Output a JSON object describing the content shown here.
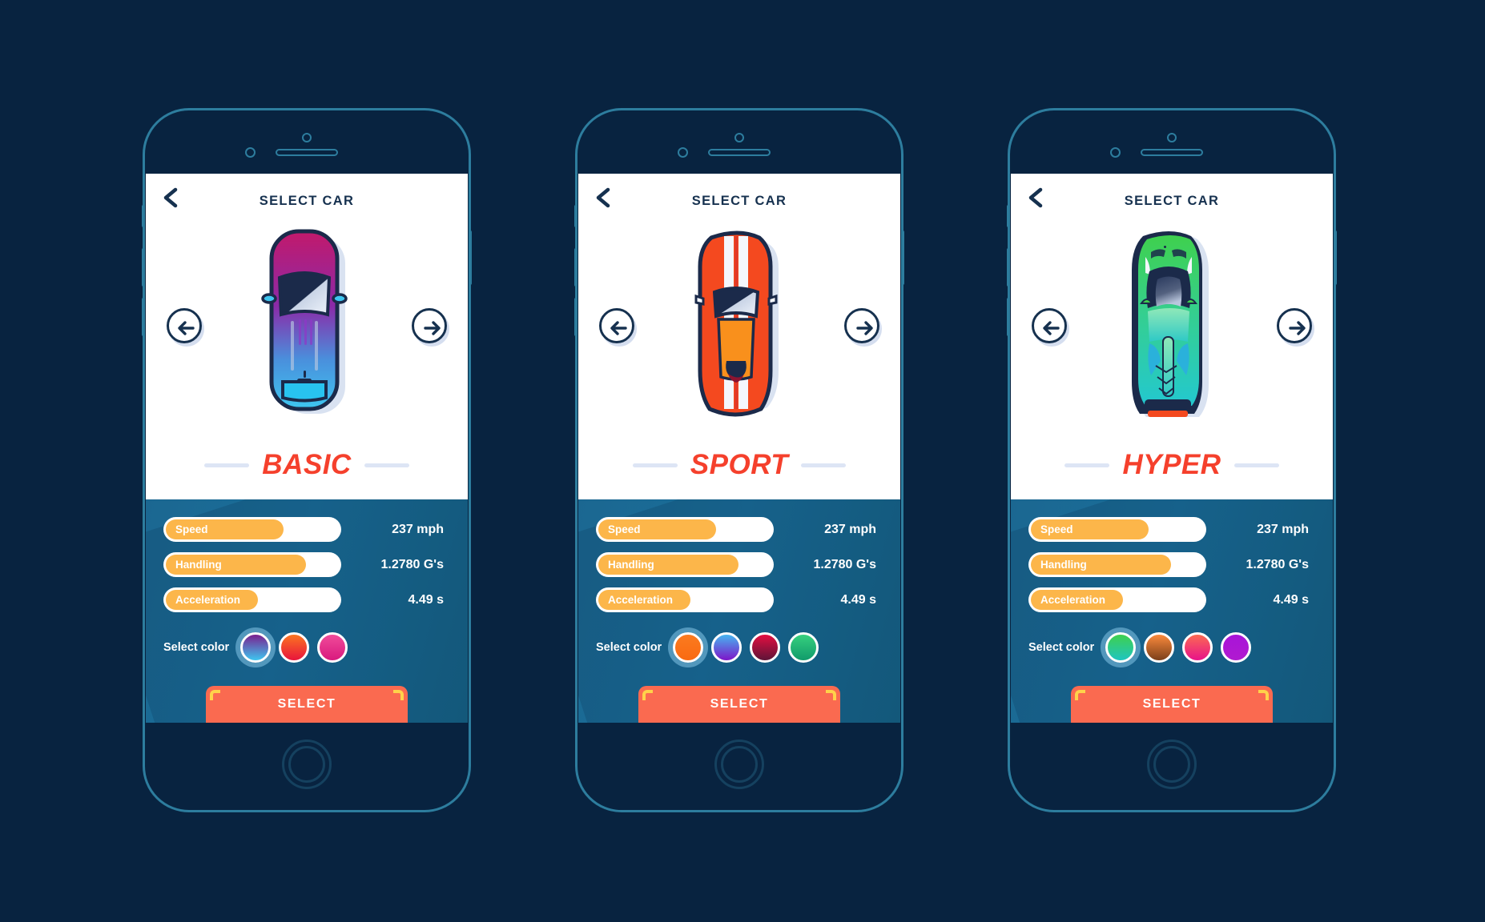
{
  "app": {
    "background_color": "#082340",
    "accent_red": "#f5402c",
    "bar_color": "#fcb64a",
    "panel_color": "#1a6f9b",
    "button_color": "#fa6a50"
  },
  "phones": [
    {
      "header": {
        "title": "SELECT CAR",
        "back_icon": "chevron-left-icon"
      },
      "carousel": {
        "prev_icon": "arrow-left-circle-icon",
        "next_icon": "arrow-right-circle-icon"
      },
      "car": {
        "name": "BASIC",
        "art": "car-top-view-sedan",
        "body_from": "#c21f6e",
        "body_to": "#3ec6f0"
      },
      "stats": [
        {
          "label": "Speed",
          "value": "237 mph",
          "pct": 66
        },
        {
          "label": "Handling",
          "value": "1.2780 G's",
          "pct": 79
        },
        {
          "label": "Acceleration",
          "value": "4.49 s",
          "pct": 52
        }
      ],
      "color_picker": {
        "label": "Select color",
        "swatches": [
          {
            "name": "purple-blue",
            "from": "#7b1f8f",
            "to": "#3ec6f0",
            "selected": true
          },
          {
            "name": "orange-red",
            "from": "#fb7521",
            "to": "#e8143c",
            "selected": false
          },
          {
            "name": "pink-magenta",
            "from": "#f04b9a",
            "to": "#d91a7e",
            "selected": false
          }
        ]
      },
      "select_button": {
        "label": "SELECT"
      }
    },
    {
      "header": {
        "title": "SELECT CAR",
        "back_icon": "chevron-left-icon"
      },
      "carousel": {
        "prev_icon": "arrow-left-circle-icon",
        "next_icon": "arrow-right-circle-icon"
      },
      "car": {
        "name": "SPORT",
        "art": "car-top-view-muscle",
        "body_from": "#f4491f",
        "body_to": "#f97d1c"
      },
      "stats": [
        {
          "label": "Speed",
          "value": "237 mph",
          "pct": 66
        },
        {
          "label": "Handling",
          "value": "1.2780 G's",
          "pct": 79
        },
        {
          "label": "Acceleration",
          "value": "4.49 s",
          "pct": 52
        }
      ],
      "color_picker": {
        "label": "Select color",
        "swatches": [
          {
            "name": "orange",
            "from": "#fb7b1f",
            "to": "#f96a12",
            "selected": true
          },
          {
            "name": "blue-purple",
            "from": "#46b6f0",
            "to": "#7d15c9",
            "selected": false
          },
          {
            "name": "dark-red",
            "from": "#e30e40",
            "to": "#5e1438",
            "selected": false
          },
          {
            "name": "green",
            "from": "#36d07e",
            "to": "#119b6b",
            "selected": false
          }
        ]
      },
      "select_button": {
        "label": "SELECT"
      }
    },
    {
      "header": {
        "title": "SELECT CAR",
        "back_icon": "chevron-left-icon"
      },
      "carousel": {
        "prev_icon": "arrow-left-circle-icon",
        "next_icon": "arrow-right-circle-icon"
      },
      "car": {
        "name": "HYPER",
        "art": "car-top-view-supercar",
        "body_from": "#3fcf4a",
        "body_to": "#2ec9c6"
      },
      "stats": [
        {
          "label": "Speed",
          "value": "237 mph",
          "pct": 66
        },
        {
          "label": "Handling",
          "value": "1.2780 G's",
          "pct": 79
        },
        {
          "label": "Acceleration",
          "value": "4.49 s",
          "pct": 52
        }
      ],
      "color_picker": {
        "label": "Select color",
        "swatches": [
          {
            "name": "green-teal",
            "from": "#3fd04e",
            "to": "#1fc5c0",
            "selected": true
          },
          {
            "name": "orange-brown",
            "from": "#fb8a3c",
            "to": "#7b3f1a",
            "selected": false
          },
          {
            "name": "pink",
            "from": "#fb6a52",
            "to": "#e8128a",
            "selected": false
          },
          {
            "name": "purple",
            "from": "#a814d8",
            "to": "#b01ad0",
            "selected": false
          }
        ]
      },
      "select_button": {
        "label": "SELECT"
      }
    }
  ]
}
